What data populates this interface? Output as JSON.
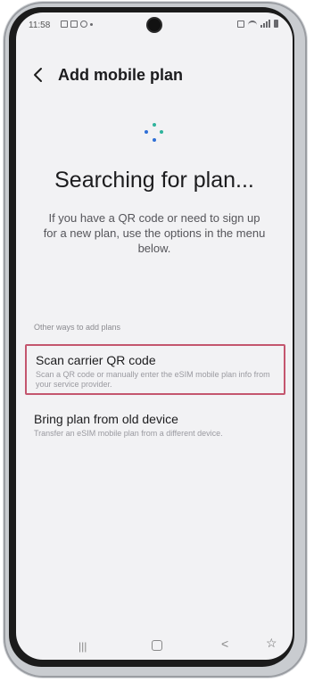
{
  "status_bar": {
    "time": "11:58",
    "left_icons": [
      "image-icon",
      "message-icon",
      "settings-icon",
      "dot-icon"
    ],
    "right_icons": [
      "mute-icon",
      "wifi-icon",
      "signal-icon",
      "battery-icon"
    ]
  },
  "header": {
    "back_icon": "chevron-left-icon",
    "title": "Add mobile plan"
  },
  "main": {
    "spinner_icon": "loading-dots-icon",
    "title": "Searching for plan...",
    "description": "If you have a QR code or need to sign up for a new plan, use the options in the menu below."
  },
  "other_ways": {
    "label": "Other ways to add plans",
    "options": [
      {
        "title": "Scan carrier QR code",
        "description": "Scan a QR code or manually enter the eSIM mobile plan info from your service provider."
      },
      {
        "title": "Bring plan from old device",
        "description": "Transfer an eSIM mobile plan from a different device."
      }
    ]
  },
  "nav_bar": {
    "icons": [
      "recents-icon",
      "home-icon",
      "back-icon",
      "accessibility-icon"
    ]
  },
  "colors": {
    "highlight_border": "#c4566e",
    "spinner_blue": "#2f6fd6",
    "spinner_teal": "#2fb39c",
    "background": "#f2f2f4"
  }
}
